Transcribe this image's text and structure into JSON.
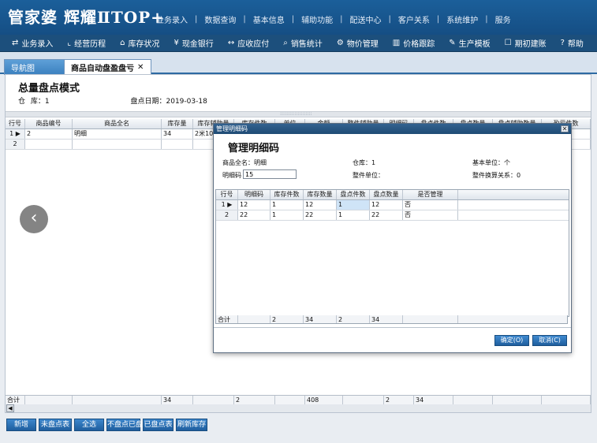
{
  "brand": {
    "logo_text": "管家婆 辉耀ⅡTOP+"
  },
  "top_nav": [
    "业务录入",
    "数据查询",
    "基本信息",
    "辅助功能",
    "配送中心",
    "客户关系",
    "系统维护",
    "服务"
  ],
  "toolbar": [
    {
      "label": "业务录入",
      "icon": "entry-icon"
    },
    {
      "label": "经营历程",
      "icon": "chart-icon"
    },
    {
      "label": "库存状况",
      "icon": "stock-icon"
    },
    {
      "label": "现金银行",
      "icon": "yen-icon"
    },
    {
      "label": "应收应付",
      "icon": "arrows-icon"
    },
    {
      "label": "销售统计",
      "icon": "search-icon"
    },
    {
      "label": "物价管理",
      "icon": "gear-icon"
    },
    {
      "label": "价格跟踪",
      "icon": "chart2-icon"
    },
    {
      "label": "生产模板",
      "icon": "wrench-icon"
    },
    {
      "label": "期初建账",
      "icon": "ledger-icon"
    },
    {
      "label": "帮助",
      "icon": "help-icon"
    }
  ],
  "tabs": {
    "nav": "导航图",
    "active": "商品自动盘盈盘亏",
    "close": "✕"
  },
  "mode": {
    "title": "总量盘点模式",
    "warehouse_label": "仓",
    "warehouse_label2": "库：1",
    "date_label": "盘点日期：2019-03-18"
  },
  "main_grid": {
    "headers": [
      "行号",
      "商品编号",
      "商品全名",
      "库存量",
      "库存辅助量",
      "库存件数",
      "单位",
      "金额",
      "整件辅助量",
      "明细码",
      "盘点件数",
      "盘点数量",
      "盘点辅助数量",
      "盈亏件数"
    ],
    "rows": [
      [
        "1 ▶",
        "2",
        "明细",
        "34",
        "2米10个",
        "",
        "",
        "",
        "",
        "",
        "",
        "",
        "",
        ""
      ],
      [
        "2",
        "",
        "",
        "",
        "",
        "",
        "",
        "",
        "",
        "",
        "",
        "",
        "",
        ""
      ]
    ],
    "totals": [
      "合计",
      "",
      "",
      "34",
      "",
      "2",
      "",
      "408",
      "",
      "2",
      "34",
      "",
      "",
      ""
    ]
  },
  "bottom_buttons": [
    "新增",
    "未盘点表",
    "全选",
    "不盘点已盘",
    "已盘点表",
    "刷新库存"
  ],
  "dialog": {
    "title": "管理明细码",
    "heading": "管理明细码",
    "product_label": "商品全名：明细",
    "warehouse_label": "仓库：1",
    "base_unit_label": "基本单位：个",
    "code_label": "明细码",
    "code_value": "15",
    "whole_unit_label": "整件单位：",
    "conversion_label": "整件换算关系：0",
    "grid_headers": [
      "行号",
      "明细码",
      "库存件数",
      "库存数量",
      "盘点件数",
      "盘点数量",
      "是否管理"
    ],
    "grid_rows": [
      [
        "1 ▶",
        "12",
        "1",
        "12",
        "1",
        "12",
        "否"
      ],
      [
        "2",
        "22",
        "1",
        "22",
        "1",
        "22",
        "否"
      ]
    ],
    "totals": [
      "合计",
      "",
      "2",
      "34",
      "2",
      "34",
      ""
    ],
    "ok_label": "确定(O)",
    "cancel_label": "取消(C)",
    "close_label": "✕"
  }
}
